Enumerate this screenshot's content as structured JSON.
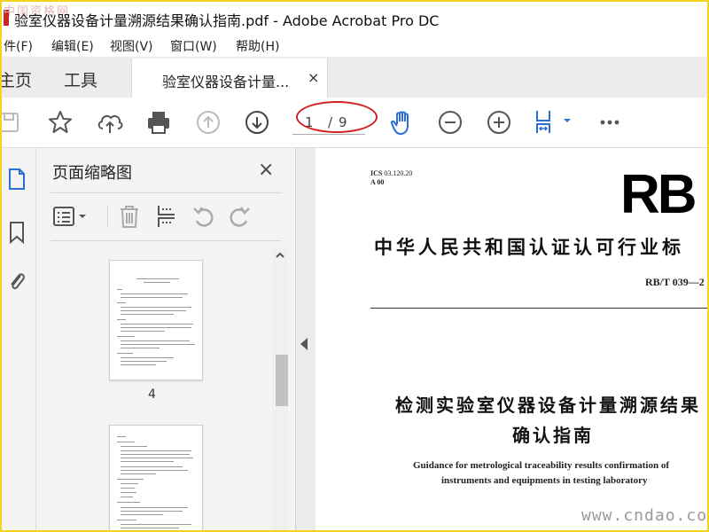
{
  "window": {
    "title": "验室仪器设备计量溯源结果确认指南.pdf - Adobe Acrobat Pro DC",
    "watermark_top_left": "中国资格网"
  },
  "menu": [
    "件(F)",
    "编辑(E)",
    "视图(V)",
    "窗口(W)",
    "帮助(H)"
  ],
  "tabs": {
    "home": "主页",
    "tools": "工具",
    "document": "验室仪器设备计量...",
    "close": "×"
  },
  "toolbar": {
    "page_current": "1",
    "page_separator": "/",
    "page_total": "9",
    "icons": [
      "save-icon",
      "bookmark-star-icon",
      "cloud-upload-icon",
      "print-icon",
      "previous-page-icon",
      "next-page-icon",
      "hand-tool-icon",
      "zoom-out-icon",
      "zoom-in-icon",
      "fit-page-icon",
      "more-icon"
    ]
  },
  "thumbnails_panel": {
    "title": "页面缩略图",
    "close": "×",
    "visible_page_label": "4"
  },
  "document": {
    "ics_label": "ICS",
    "ics_code": "03.120.20",
    "classification": "A 00",
    "logo": "RB",
    "org_title": "中华人民共和国认证认可行业标",
    "standard_code": "RB/T 039—2",
    "title_line1": "检测实验室仪器设备计量溯源结果",
    "title_line2": "确认指南",
    "english_line1": "Guidance for metrological traceability results confirmation of",
    "english_line2": "instruments and equipments in testing laboratory"
  },
  "watermark_bottom_right": "www.cndao.com",
  "colors": {
    "accent_blue": "#2a6fd6",
    "annotation_red": "#d42020",
    "frame_yellow": "#f5d31a"
  }
}
